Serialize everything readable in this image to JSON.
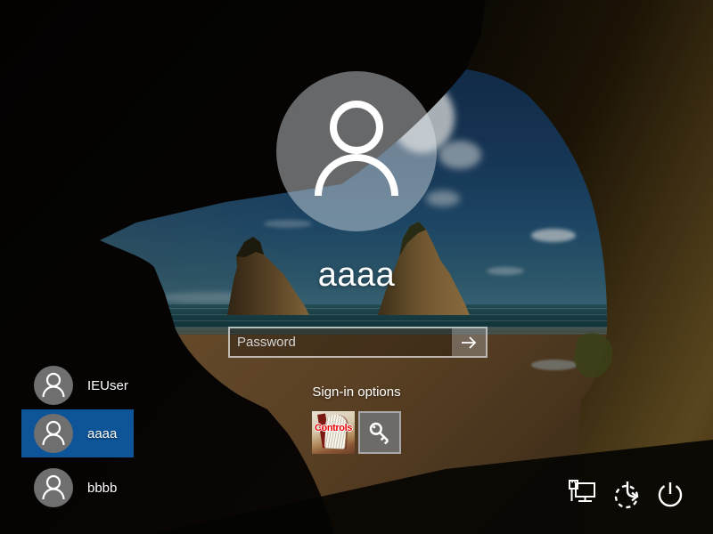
{
  "signin": {
    "username": "aaaa",
    "password_placeholder": "Password",
    "options_label": "Sign-in options",
    "custom_provider_label": "Controls",
    "submit_icon": "arrow-right-icon",
    "option_icons": [
      "custom-provider-book-image",
      "key-icon"
    ]
  },
  "users": [
    {
      "name": "IEUser",
      "selected": false
    },
    {
      "name": "aaaa",
      "selected": true
    },
    {
      "name": "bbbb",
      "selected": false
    }
  ],
  "system_buttons": [
    {
      "icon": "network-icon"
    },
    {
      "icon": "ease-of-access-icon"
    },
    {
      "icon": "power-icon"
    }
  ],
  "colors": {
    "selected_user_highlight": "#0d5498",
    "signin_tile_background": "#707070",
    "controls_label_color": "#e80000"
  }
}
